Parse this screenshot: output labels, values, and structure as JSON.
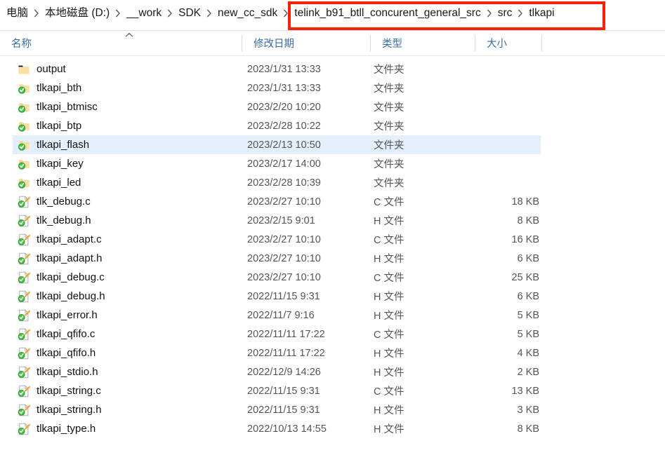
{
  "window": {
    "title": "tlkapi"
  },
  "breadcrumb": {
    "separator": "chevron-right-icon",
    "items": [
      {
        "label": "电脑"
      },
      {
        "label": "本地磁盘 (D:)"
      },
      {
        "label": "__work"
      },
      {
        "label": "SDK"
      },
      {
        "label": "new_cc_sdk"
      },
      {
        "label": "telink_b91_btll_concurent_general_src"
      },
      {
        "label": "src"
      },
      {
        "label": "tlkapi"
      }
    ],
    "highlight_color": "#f92208",
    "highlighted_from_index": 5
  },
  "columns": {
    "name": "名称",
    "date_modified": "修改日期",
    "type": "类型",
    "size": "大小",
    "sort_column": "名称",
    "sort_direction": "ascending"
  },
  "selection": {
    "selected_name": "tlkapi_flash",
    "highlight_color": "#e3f0fc"
  },
  "rows": [
    {
      "name": "output",
      "date": "2023/1/31 13:33",
      "type": "文件夹",
      "size": "",
      "icon": "folder-icon",
      "selected": false
    },
    {
      "name": "tlkapi_bth",
      "date": "2023/1/31 13:33",
      "type": "文件夹",
      "size": "",
      "icon": "folder-checked-icon",
      "selected": false
    },
    {
      "name": "tlkapi_btmisc",
      "date": "2023/2/20 10:20",
      "type": "文件夹",
      "size": "",
      "icon": "folder-checked-icon",
      "selected": false
    },
    {
      "name": "tlkapi_btp",
      "date": "2023/2/28 10:22",
      "type": "文件夹",
      "size": "",
      "icon": "folder-checked-icon",
      "selected": false
    },
    {
      "name": "tlkapi_flash",
      "date": "2023/2/13 10:50",
      "type": "文件夹",
      "size": "",
      "icon": "folder-checked-icon",
      "selected": true
    },
    {
      "name": "tlkapi_key",
      "date": "2023/2/17 14:00",
      "type": "文件夹",
      "size": "",
      "icon": "folder-checked-icon",
      "selected": false
    },
    {
      "name": "tlkapi_led",
      "date": "2023/2/28 10:39",
      "type": "文件夹",
      "size": "",
      "icon": "folder-checked-icon",
      "selected": false
    },
    {
      "name": "tlk_debug.c",
      "date": "2023/2/27 10:10",
      "type": "C 文件",
      "size": "18 KB",
      "icon": "source-file-checked-icon",
      "selected": false
    },
    {
      "name": "tlk_debug.h",
      "date": "2023/2/15 9:01",
      "type": "H 文件",
      "size": "8 KB",
      "icon": "source-file-checked-icon",
      "selected": false
    },
    {
      "name": "tlkapi_adapt.c",
      "date": "2023/2/27 10:10",
      "type": "C 文件",
      "size": "16 KB",
      "icon": "source-file-checked-icon",
      "selected": false
    },
    {
      "name": "tlkapi_adapt.h",
      "date": "2023/2/27 10:10",
      "type": "H 文件",
      "size": "6 KB",
      "icon": "source-file-checked-icon",
      "selected": false
    },
    {
      "name": "tlkapi_debug.c",
      "date": "2023/2/27 10:10",
      "type": "C 文件",
      "size": "25 KB",
      "icon": "source-file-checked-icon",
      "selected": false
    },
    {
      "name": "tlkapi_debug.h",
      "date": "2022/11/15 9:31",
      "type": "H 文件",
      "size": "6 KB",
      "icon": "source-file-checked-icon",
      "selected": false
    },
    {
      "name": "tlkapi_error.h",
      "date": "2022/11/7 9:16",
      "type": "H 文件",
      "size": "5 KB",
      "icon": "source-file-checked-icon",
      "selected": false
    },
    {
      "name": "tlkapi_qfifo.c",
      "date": "2022/11/11 17:22",
      "type": "C 文件",
      "size": "5 KB",
      "icon": "source-file-checked-icon",
      "selected": false
    },
    {
      "name": "tlkapi_qfifo.h",
      "date": "2022/11/11 17:22",
      "type": "H 文件",
      "size": "4 KB",
      "icon": "source-file-checked-icon",
      "selected": false
    },
    {
      "name": "tlkapi_stdio.h",
      "date": "2022/12/9 14:26",
      "type": "H 文件",
      "size": "2 KB",
      "icon": "source-file-checked-icon",
      "selected": false
    },
    {
      "name": "tlkapi_string.c",
      "date": "2022/11/15 9:31",
      "type": "C 文件",
      "size": "13 KB",
      "icon": "source-file-checked-icon",
      "selected": false
    },
    {
      "name": "tlkapi_string.h",
      "date": "2022/11/15 9:31",
      "type": "H 文件",
      "size": "3 KB",
      "icon": "source-file-checked-icon",
      "selected": false
    },
    {
      "name": "tlkapi_type.h",
      "date": "2022/10/13 14:55",
      "type": "H 文件",
      "size": "8 KB",
      "icon": "source-file-checked-icon",
      "selected": false
    }
  ]
}
